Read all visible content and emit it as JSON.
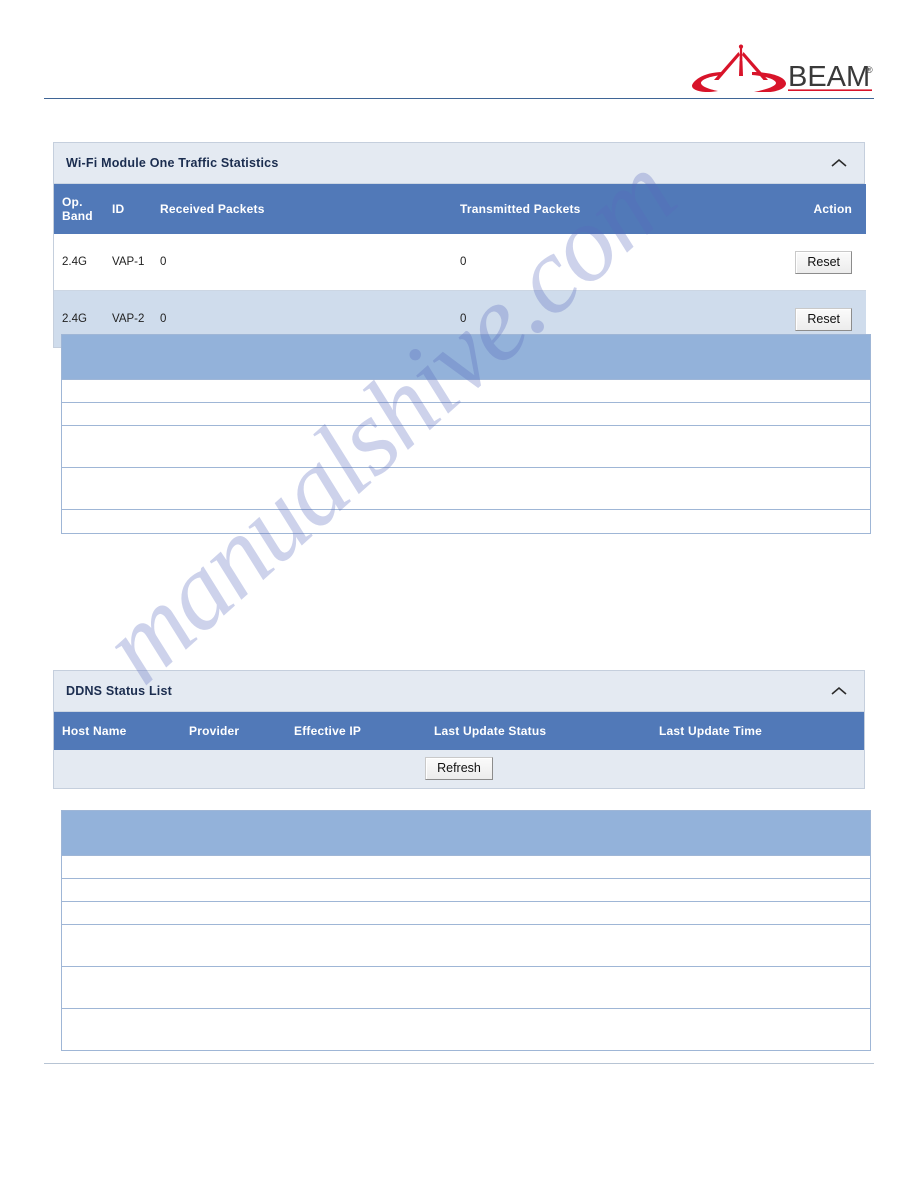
{
  "brand": {
    "name": "BEAM",
    "registered_mark": "®",
    "logo_icon": "beam-antenna-logo",
    "logo_color": "#d8142a",
    "wordmark_color": "#3a3a3a"
  },
  "watermark": {
    "text": "manualshive.com"
  },
  "colors": {
    "header_blue": "#5179b8",
    "light_header_blue": "#93b2da",
    "panel_title_bg": "#e4eaf2",
    "row_alt": "#cfdcec",
    "rule_top": "#3f6596",
    "rule_bottom": "#b7c4d4"
  },
  "wifi_panel": {
    "title": "Wi-Fi Module One Traffic Statistics",
    "collapse_icon": "chevron-up-icon",
    "columns": [
      "Op. Band",
      "ID",
      "Received Packets",
      "Transmitted Packets",
      "Action"
    ],
    "rows": [
      {
        "op_band": "2.4G",
        "id": "VAP-1",
        "received_packets": "0",
        "transmitted_packets": "0",
        "action_label": "Reset"
      },
      {
        "op_band": "2.4G",
        "id": "VAP-2",
        "received_packets": "0",
        "transmitted_packets": "0",
        "action_label": "Reset"
      }
    ]
  },
  "blank_table_one": {
    "header_text": "",
    "rows": [
      "",
      "",
      "",
      "",
      ""
    ]
  },
  "ddns_panel": {
    "title": "DDNS Status List",
    "collapse_icon": "chevron-up-icon",
    "columns": [
      "Host Name",
      "Provider",
      "Effective IP",
      "Last Update Status",
      "Last Update Time"
    ],
    "rows": [],
    "refresh_label": "Refresh"
  },
  "blank_table_two": {
    "header_text": "",
    "rows": [
      "",
      "",
      "",
      "",
      "",
      ""
    ]
  }
}
